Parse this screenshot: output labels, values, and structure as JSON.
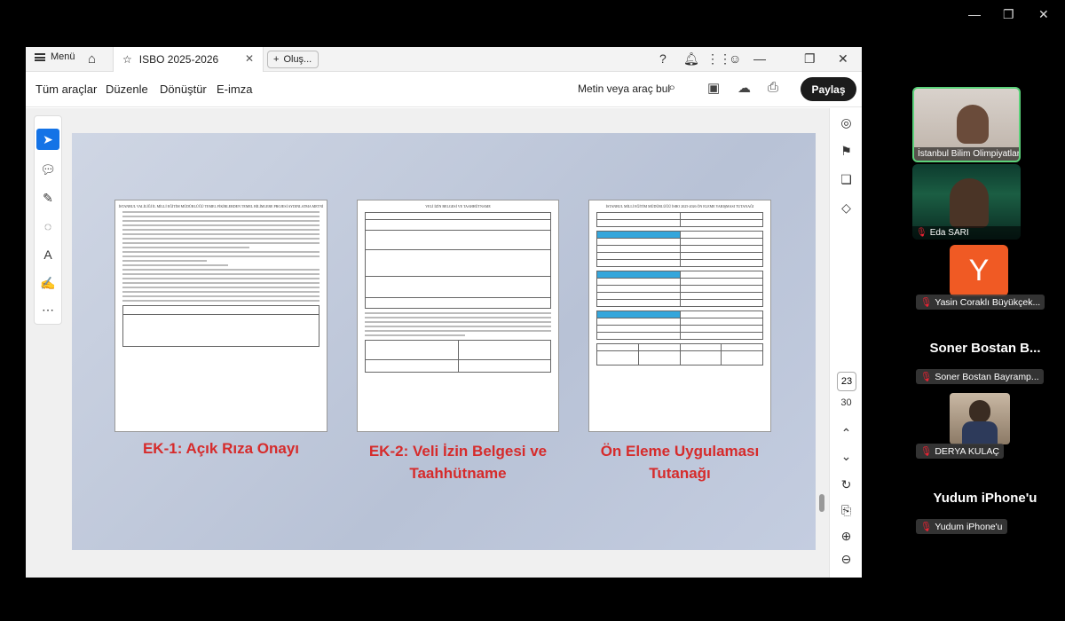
{
  "window_controls": {
    "min": "—",
    "max": "❐",
    "close": "✕"
  },
  "titlebar": {
    "menu_label": "Menü",
    "tab_title": "ISBO 2025-2026",
    "new_tab_label": "Oluş..."
  },
  "toolbar": {
    "items": [
      "Tüm araçlar",
      "Düzenle",
      "Dönüştür",
      "E-imza"
    ],
    "search_placeholder": "Metin veya araç bul",
    "share_label": "Paylaş"
  },
  "slide": {
    "captions": {
      "ek1": "EK-1: Açık Rıza Onayı",
      "ek2_line1": "EK-2: Veli İzin Belgesi ve",
      "ek2_line2": "Taahhütname",
      "ek3_line1": "Ön Eleme Uygulaması",
      "ek3_line2": "Tutanağı"
    },
    "doc_titles": {
      "ek1": "İSTANBUL VALİLİĞİ İL MİLLİ EĞİTİM MÜDÜRLÜĞÜ TEMEL FİKİRLERDEN TEMEL BİLİMLERE PROJESİ AYDINLATMA METNİ",
      "ek2": "VELİ İZİN BELGESİ VE TAAHHÜTNAME",
      "ek3": "İSTANBUL MİLLİ EĞİTİM MÜDÜRLÜĞÜ İSBO 2025-2026 ÖN ELEME YARIŞMASI TUTANAĞI"
    }
  },
  "pager": {
    "current": "23",
    "total": "30"
  },
  "participants": [
    {
      "name": "İstanbul Bilim Olimpiyatları"
    },
    {
      "name": "Eda SARI"
    },
    {
      "name": "Yasin Coraklı Büyükçek...",
      "initial": "Y"
    },
    {
      "name": "Soner Bostan Bayramp...",
      "display": "Soner  Bostan  B..."
    },
    {
      "name": "DERYA KULAÇ"
    },
    {
      "name": "Yudum iPhone'u",
      "display": "Yudum iPhone'u"
    }
  ]
}
